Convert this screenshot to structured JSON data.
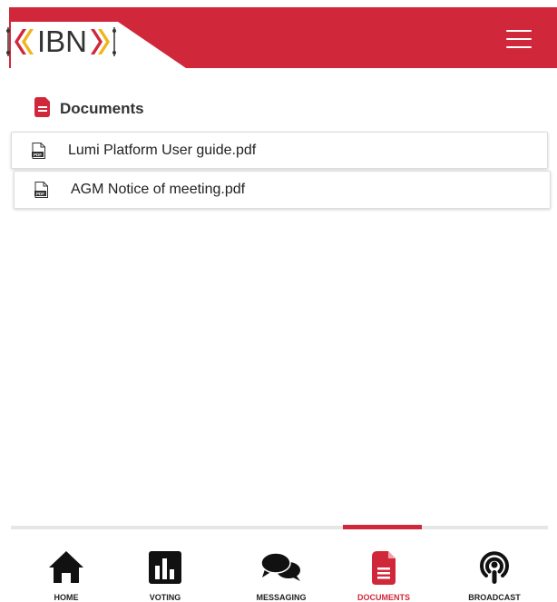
{
  "header": {
    "logo_text": "IBN",
    "brand_color": "#d0283a",
    "menu_icon": "hamburger-icon"
  },
  "section": {
    "title": "Documents",
    "icon": "document-icon"
  },
  "documents": [
    {
      "name": "Lumi Platform User guide.pdf",
      "icon": "pdf-file-icon"
    },
    {
      "name": "AGM Notice of meeting.pdf",
      "icon": "pdf-file-icon"
    }
  ],
  "nav": {
    "active": "DOCUMENTS",
    "items": [
      {
        "label": "HOME",
        "icon": "home-icon"
      },
      {
        "label": "VOTING",
        "icon": "bar-chart-icon"
      },
      {
        "label": "MESSAGING",
        "icon": "chat-icon"
      },
      {
        "label": "DOCUMENTS",
        "icon": "document-icon"
      },
      {
        "label": "BROADCAST",
        "icon": "broadcast-icon"
      }
    ]
  }
}
